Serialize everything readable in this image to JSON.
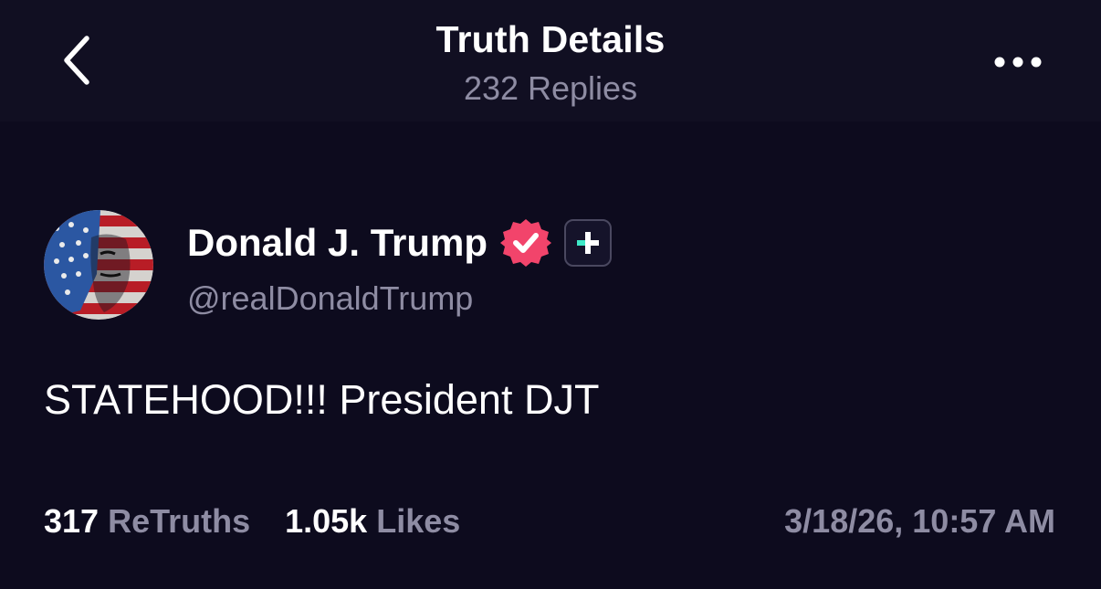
{
  "header": {
    "title": "Truth Details",
    "subtitle": "232 Replies",
    "back_icon": "chevron-left-icon",
    "more_icon": "more-horizontal-icon"
  },
  "author": {
    "name": "Donald J. Trump",
    "handle": "@realDonaldTrump",
    "verified_icon": "verified-badge-icon",
    "verified_color": "#f2446b",
    "plus_icon": "truth-plus-icon",
    "plus_color": "#3ee8c7"
  },
  "post": {
    "text": "STATEHOOD!!! President DJT"
  },
  "stats": {
    "retruths_count": "317",
    "retruths_label": "ReTruths",
    "likes_count": "1.05k",
    "likes_label": "Likes",
    "timestamp": "3/18/26, 10:57 AM"
  },
  "colors": {
    "background": "#0d0b1e",
    "header_background": "#110f22",
    "muted_text": "#8e8ca3"
  }
}
